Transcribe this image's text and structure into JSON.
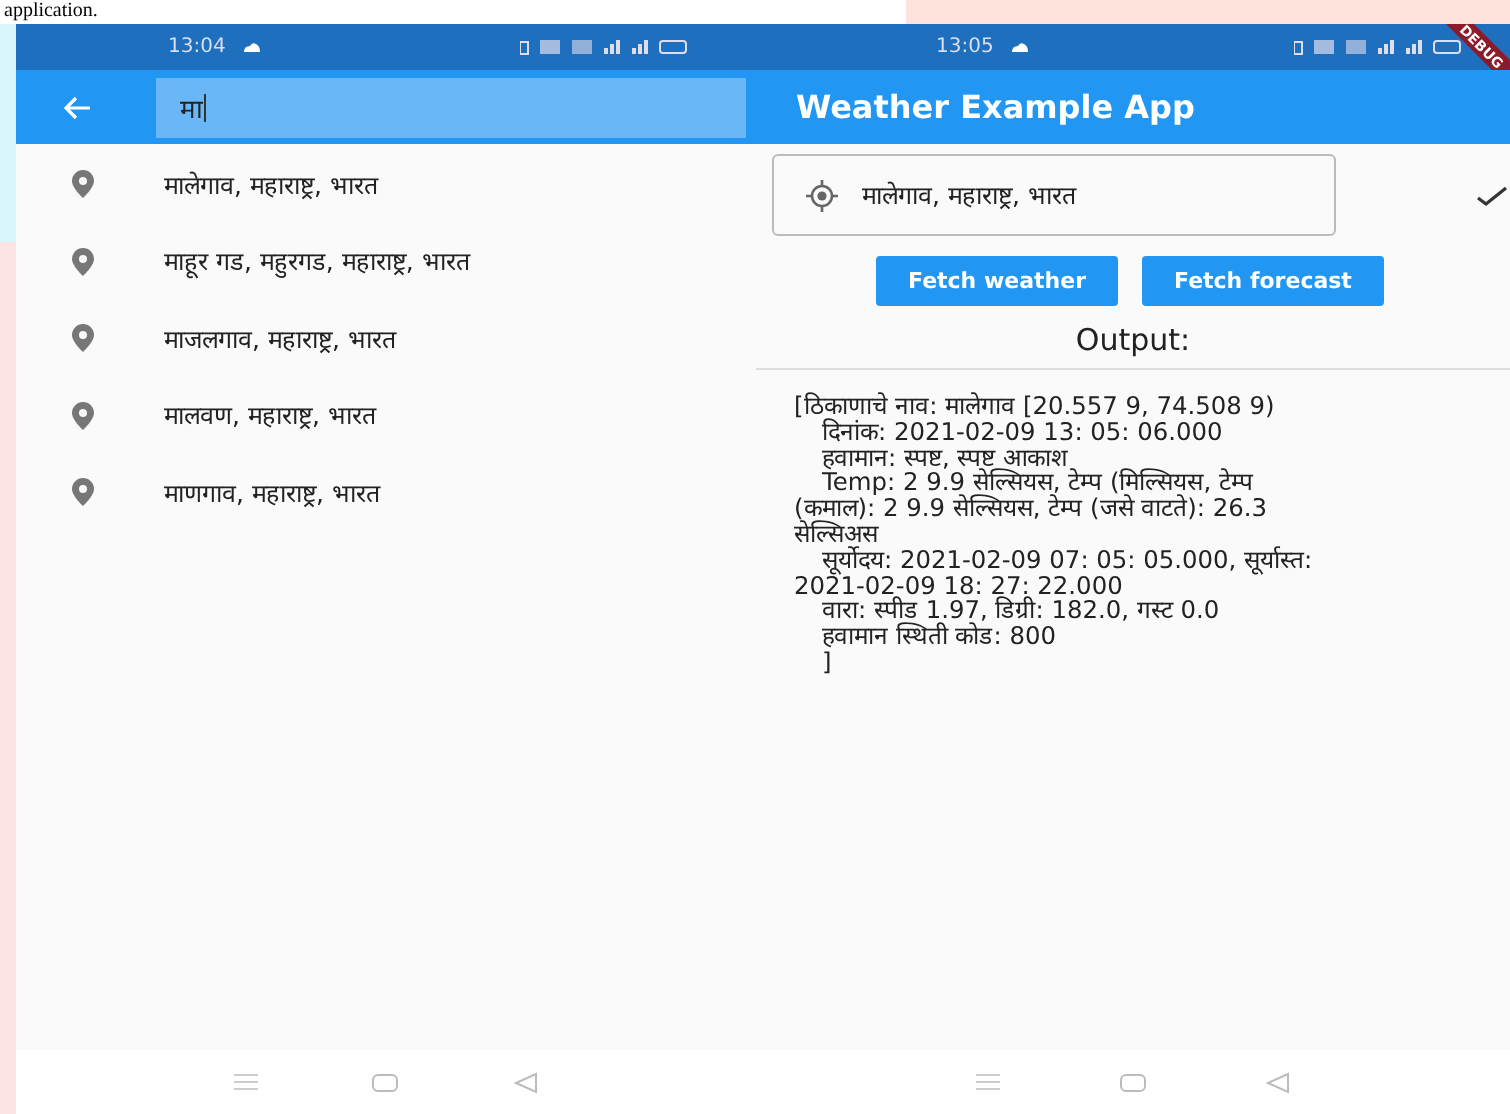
{
  "caption": "application.",
  "phones": [
    {
      "kind": "search",
      "status_bar": {
        "time": "13:04"
      },
      "search": {
        "value": "मा"
      },
      "results": [
        {
          "label": "मालेगाव, महाराष्ट्र, भारत"
        },
        {
          "label": "माहूर गड, महुरगड, महाराष्ट्र, भारत"
        },
        {
          "label": "माजलगाव, महाराष्ट्र, भारत"
        },
        {
          "label": "मालवण, महाराष्ट्र, भारत"
        },
        {
          "label": "माणगाव, महाराष्ट्र, भारत"
        }
      ]
    },
    {
      "kind": "weather",
      "status_bar": {
        "time": "13:05"
      },
      "debug_banner": "DEBUG",
      "title": "Weather Example App",
      "location_field": {
        "value": "मालेगाव, महाराष्ट्र, भारत"
      },
      "buttons": [
        "Fetch weather",
        "Fetch forecast"
      ],
      "output_label": "Output:",
      "output_lines": [
        {
          "text": "[ठिकाणाचे नाव: मालेगाव [20.557 9, 74.508 9)",
          "indent": false
        },
        {
          "text": "दिनांक: 2021-02-09 13: 05: 06.000",
          "indent": true
        },
        {
          "text": "हवामान: स्पष्ट, स्पष्ट आकाश",
          "indent": true
        },
        {
          "text": "Temp: 2 9.9 सेल्सियस, टेम्प (मिल्सियस, टेम्प",
          "indent": true
        },
        {
          "text": "(कमाल): 2 9.9 सेल्सियस, टेम्प (जसे वाटते): 26.3",
          "indent": false
        },
        {
          "text": "सेल्सिअस",
          "indent": false
        },
        {
          "text": "सूर्योदय: 2021-02-09 07: 05: 05.000, सूर्यास्त:",
          "indent": true
        },
        {
          "text": "2021-02-09 18: 27: 22.000",
          "indent": false
        },
        {
          "text": "वारा: स्पीड 1.97, डिग्री: 182.0, गस्ट 0.0",
          "indent": true
        },
        {
          "text": "हवामान स्थिती कोड: 800",
          "indent": true
        },
        {
          "text": "]",
          "indent": true
        }
      ]
    }
  ]
}
